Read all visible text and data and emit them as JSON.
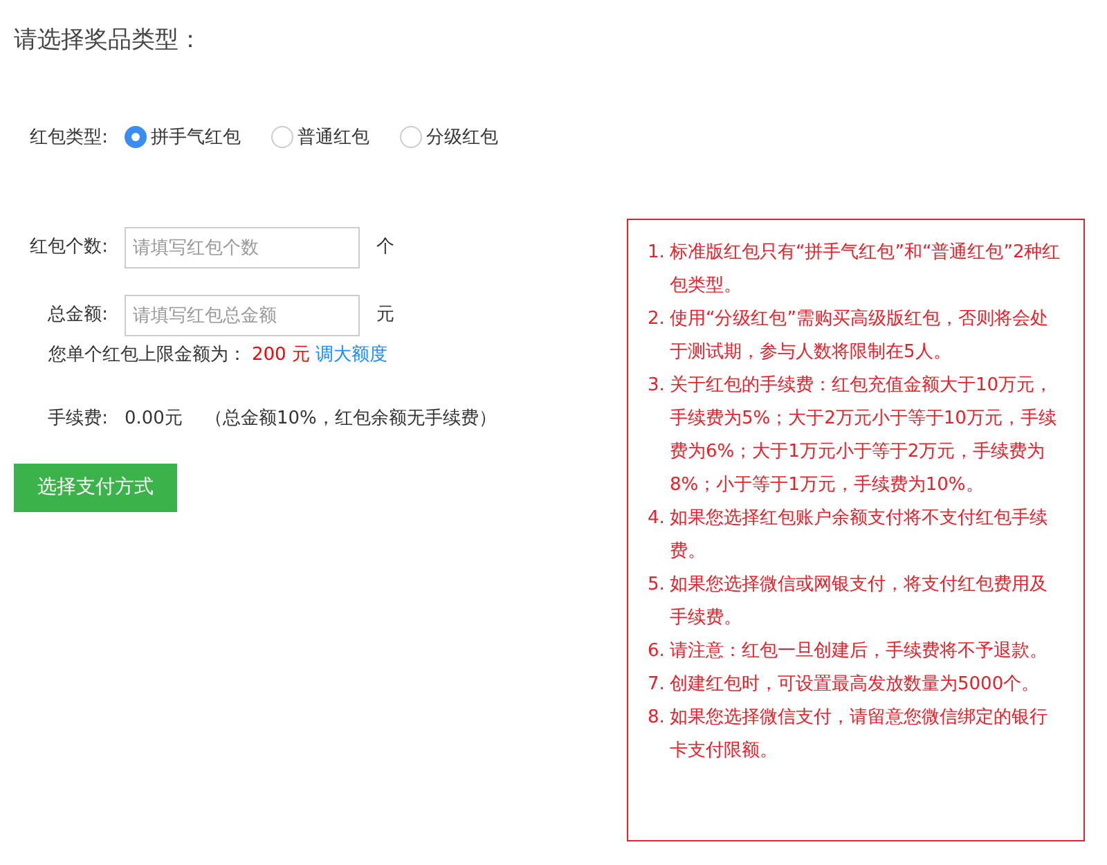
{
  "title": "请选择奖品类型：",
  "type_field": {
    "label": "红包类型:",
    "options": [
      {
        "label": "拼手气红包",
        "selected": true
      },
      {
        "label": "普通红包",
        "selected": false
      },
      {
        "label": "分级红包",
        "selected": false
      }
    ]
  },
  "count_field": {
    "label": "红包个数:",
    "placeholder": "请填写红包个数",
    "unit": "个"
  },
  "amount_field": {
    "label": "总金额:",
    "placeholder": "请填写红包总金额",
    "unit": "元"
  },
  "limit": {
    "text": "您单个红包上限金额为：",
    "amount": "200 元",
    "link": "调大额度"
  },
  "fee": {
    "label": "手续费:",
    "value": "0.00元",
    "note": "（总金额10%，红包余额无手续费）"
  },
  "submit_button": "选择支付方式",
  "notes": [
    {
      "number": "1.",
      "text": "标准版红包只有“拼手气红包”和“普通红包”2种红包类型。"
    },
    {
      "number": "2.",
      "text": "使用“分级红包”需购买高级版红包，否则将会处于测试期，参与人数将限制在5人。"
    },
    {
      "number": "3.",
      "text": "关于红包的手续费：红包充值金额大于10万元，手续费为5%；大于2万元小于等于10万元，手续费为6%；大于1万元小于等于2万元，手续费为8%；小于等于1万元，手续费为10%。"
    },
    {
      "number": "4.",
      "text": "如果您选择红包账户余额支付将不支付红包手续费。"
    },
    {
      "number": "5.",
      "text": "如果您选择微信或网银支付，将支付红包费用及手续费。"
    },
    {
      "number": "6.",
      "text": "请注意：红包一旦创建后，手续费将不予退款。"
    },
    {
      "number": "7.",
      "text": "创建红包时，可设置最高发放数量为5000个。"
    },
    {
      "number": "8.",
      "text": "如果您选择微信支付，请留意您微信绑定的银行卡支付限额。"
    }
  ]
}
